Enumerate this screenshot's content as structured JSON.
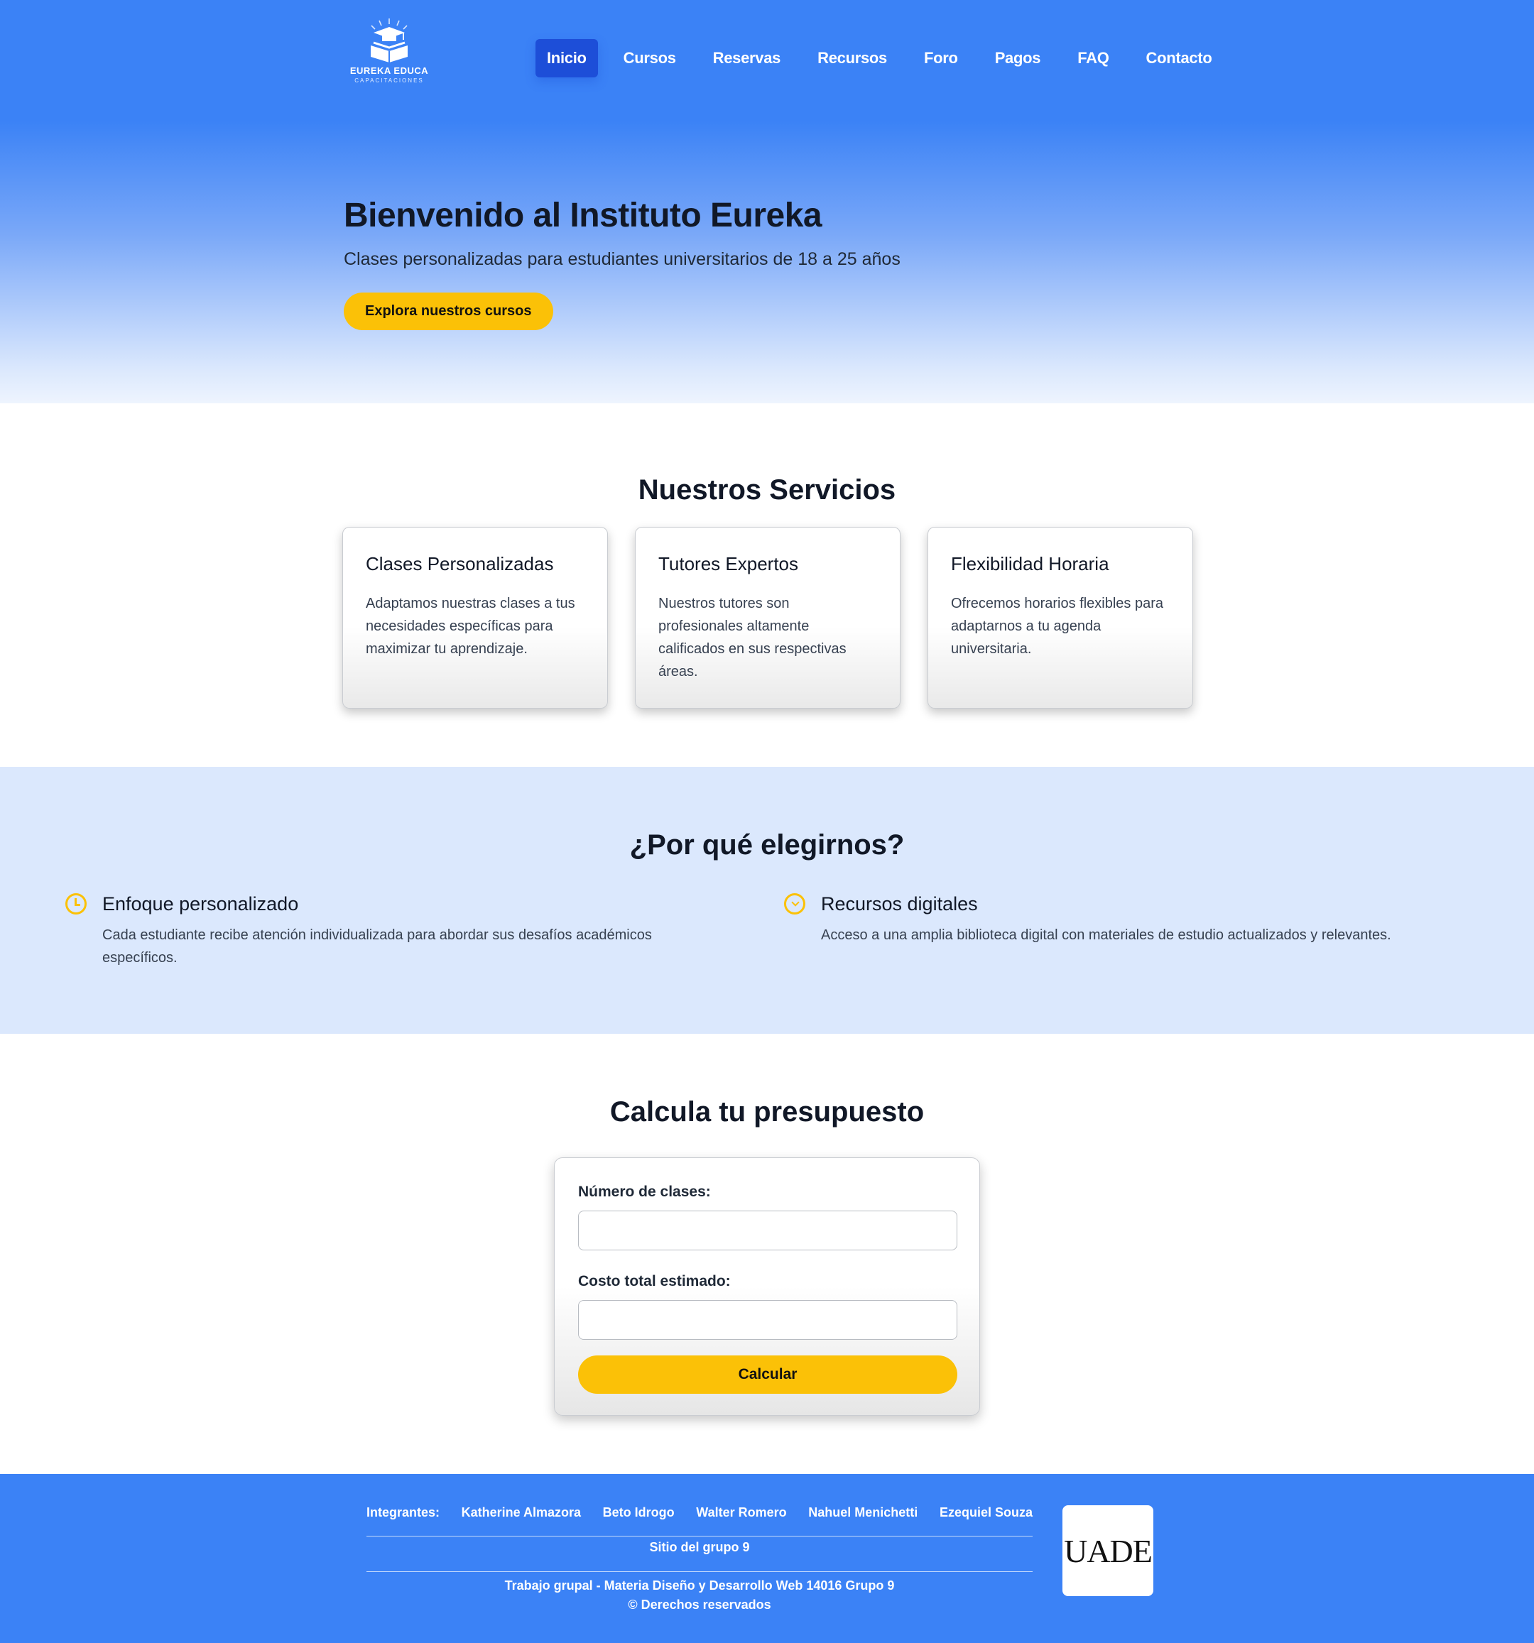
{
  "brand": {
    "name": "EUREKA EDUCA",
    "tagline": "CAPACITACIONES"
  },
  "nav": {
    "items": [
      "Inicio",
      "Cursos",
      "Reservas",
      "Recursos",
      "Foro",
      "Pagos",
      "FAQ",
      "Contacto"
    ],
    "active": "Inicio"
  },
  "hero": {
    "title": "Bienvenido al Instituto Eureka",
    "subtitle": "Clases personalizadas para estudiantes universitarios de 18 a 25 años",
    "cta": "Explora nuestros cursos"
  },
  "services": {
    "title": "Nuestros Servicios",
    "cards": [
      {
        "title": "Clases Personalizadas",
        "text": "Adaptamos nuestras clases a tus necesidades específicas para maximizar tu aprendizaje."
      },
      {
        "title": "Tutores Expertos",
        "text": "Nuestros tutores son profesionales altamente calificados en sus respectivas áreas."
      },
      {
        "title": "Flexibilidad Horaria",
        "text": "Ofrecemos horarios flexibles para adaptarnos a tu agenda universitaria."
      }
    ]
  },
  "why": {
    "title": "¿Por qué elegirnos?",
    "items": [
      {
        "icon": "clock-icon",
        "title": "Enfoque personalizado",
        "text": "Cada estudiante recibe atención individualizada para abordar sus desafíos académicos específicos."
      },
      {
        "icon": "chevron-down-circle-icon",
        "title": "Recursos digitales",
        "text": "Acceso a una amplia biblioteca digital con materiales de estudio actualizados y relevantes."
      }
    ]
  },
  "calculator": {
    "title": "Calcula tu presupuesto",
    "classes_label": "Número de clases:",
    "classes_value": "",
    "cost_label": "Costo total estimado:",
    "cost_value": "",
    "button": "Calcular"
  },
  "footer": {
    "members_label": "Integrantes:",
    "members": [
      "Katherine Almazora",
      "Beto Idrogo",
      "Walter Romero",
      "Nahuel Menichetti",
      "Ezequiel Souza"
    ],
    "site_link": "Sitio del grupo 9",
    "credits_line1": "Trabajo grupal - Materia Diseño y Desarrollo Web 14016 Grupo 9",
    "credits_line2": "© Derechos reservados",
    "university_logo": "UADE"
  },
  "colors": {
    "primary": "#3b82f6",
    "nav_active": "#1d4ed8",
    "accent": "#fbc107",
    "why_bg": "#dbe8fd"
  }
}
